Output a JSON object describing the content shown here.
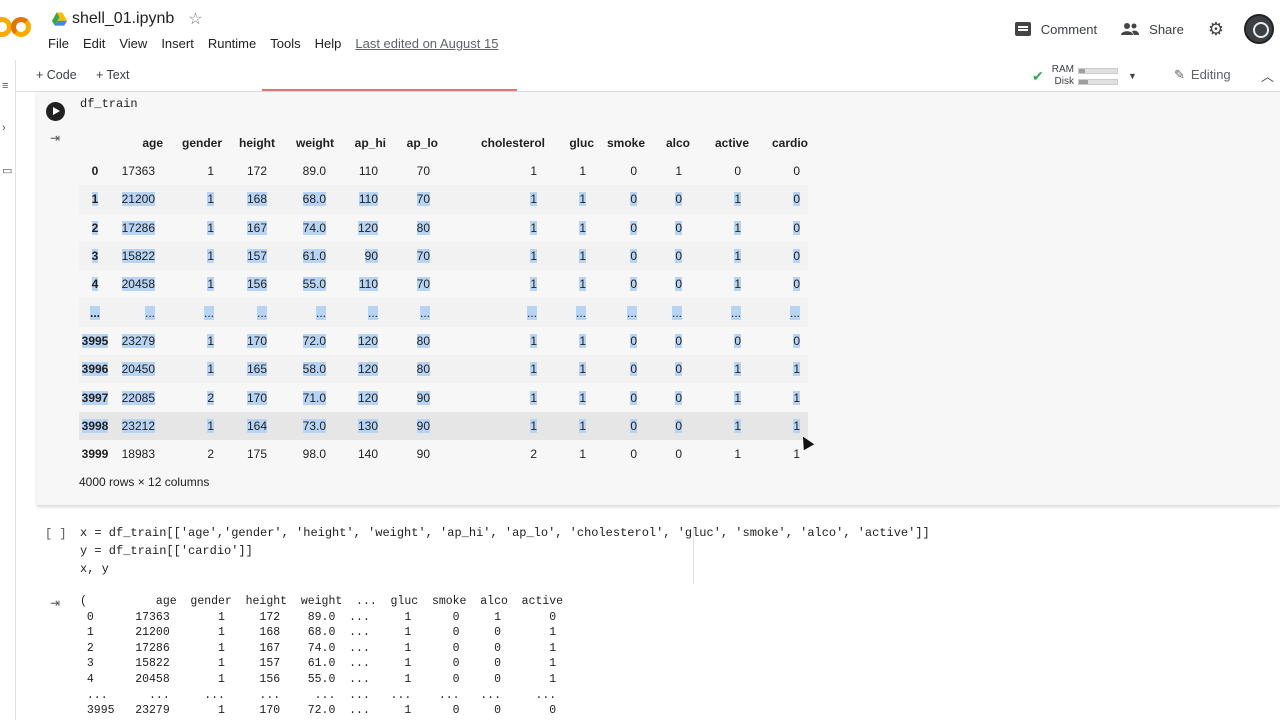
{
  "app": {
    "notebook_title": "shell_01.ipynb",
    "menu": [
      "File",
      "Edit",
      "View",
      "Insert",
      "Runtime",
      "Tools",
      "Help"
    ],
    "last_edited": "Last edited on August 15",
    "comment_label": "Comment",
    "share_label": "Share"
  },
  "toolbar": {
    "add_code": "+ Code",
    "add_text": "+ Text",
    "ram_label": "RAM",
    "disk_label": "Disk",
    "ram_usage": 0.15,
    "disk_usage": 0.25,
    "editing_label": "Editing"
  },
  "cell1": {
    "code": "df_train",
    "columns": [
      "",
      "age",
      "gender",
      "height",
      "weight",
      "ap_hi",
      "ap_lo",
      "cholesterol",
      "gluc",
      "smoke",
      "alco",
      "active",
      "cardio"
    ],
    "rows": [
      [
        "0",
        "17363",
        "1",
        "172",
        "89.0",
        "110",
        "70",
        "1",
        "1",
        "0",
        "1",
        "0",
        "0"
      ],
      [
        "1",
        "21200",
        "1",
        "168",
        "68.0",
        "110",
        "70",
        "1",
        "1",
        "0",
        "0",
        "1",
        "0"
      ],
      [
        "2",
        "17286",
        "1",
        "167",
        "74.0",
        "120",
        "80",
        "1",
        "1",
        "0",
        "0",
        "1",
        "0"
      ],
      [
        "3",
        "15822",
        "1",
        "157",
        "61.0",
        "90",
        "70",
        "1",
        "1",
        "0",
        "0",
        "1",
        "0"
      ],
      [
        "4",
        "20458",
        "1",
        "156",
        "55.0",
        "110",
        "70",
        "1",
        "1",
        "0",
        "0",
        "1",
        "0"
      ],
      [
        "...",
        "...",
        "...",
        "...",
        "...",
        "...",
        "...",
        "...",
        "...",
        "...",
        "...",
        "...",
        "..."
      ],
      [
        "3995",
        "23279",
        "1",
        "170",
        "72.0",
        "120",
        "80",
        "1",
        "1",
        "0",
        "0",
        "0",
        "0"
      ],
      [
        "3996",
        "20450",
        "1",
        "165",
        "58.0",
        "120",
        "80",
        "1",
        "1",
        "0",
        "0",
        "1",
        "1"
      ],
      [
        "3997",
        "22085",
        "2",
        "170",
        "71.0",
        "120",
        "90",
        "1",
        "1",
        "0",
        "0",
        "1",
        "1"
      ],
      [
        "3998",
        "23212",
        "1",
        "164",
        "73.0",
        "130",
        "90",
        "1",
        "1",
        "0",
        "0",
        "1",
        "1"
      ],
      [
        "3999",
        "18983",
        "2",
        "175",
        "98.0",
        "140",
        "90",
        "2",
        "1",
        "0",
        "0",
        "1",
        "1"
      ]
    ],
    "shape": "4000 rows × 12 columns"
  },
  "cell2": {
    "bracket": "[ ]",
    "line1": "x = df_train[['age','gender', 'height', 'weight', 'ap_hi', 'ap_lo', 'cholesterol', 'gluc', 'smoke', 'alco', 'active']]",
    "line2": "y = df_train[['cardio']]",
    "line3": "x, y",
    "output": "(          age  gender  height  weight  ...  gluc  smoke  alco  active\n 0      17363       1     172    89.0  ...     1      0     1       0\n 1      21200       1     168    68.0  ...     1      0     0       1\n 2      17286       1     167    74.0  ...     1      0     0       1\n 3      15822       1     157    61.0  ...     1      0     0       1\n 4      20458       1     156    55.0  ...     1      0     0       1\n ...      ...     ...     ...     ...  ...   ...    ...   ...     ...\n 3995   23279       1     170    72.0  ...     1      0     0       0"
  },
  "colors": {
    "selection": "#b3d1f5",
    "accent_orange": "#f9ab00",
    "ok_green": "#34a853"
  }
}
